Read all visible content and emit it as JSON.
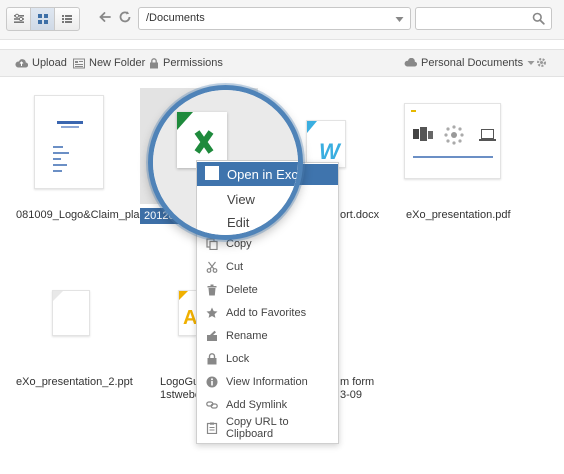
{
  "toolbar": {
    "path": "/Documents",
    "search_value": ""
  },
  "actions": {
    "upload": "Upload",
    "new_folder": "New Folder",
    "permissions": "Permissions",
    "drive": "Personal Documents"
  },
  "files": [
    {
      "name": "081009_Logo&Claim_pla"
    },
    {
      "name": "20120114_"
    },
    {
      "name": "ort.docx"
    },
    {
      "name": "eXo_presentation.pdf"
    },
    {
      "name": "eXo_presentation_2.ppt"
    },
    {
      "name_line1": "LogoGu",
      "name_line2": "1stwebc"
    },
    {
      "name_line1": "m form",
      "name_line2": "3-09"
    }
  ],
  "context_menu": {
    "items": [
      {
        "label": "Open in Excel",
        "icon": "excel-icon"
      },
      {
        "label": "View",
        "icon": "layers-icon"
      },
      {
        "label": "Edit",
        "icon": "edit-icon"
      },
      {
        "label": "Copy",
        "icon": "copy-icon"
      },
      {
        "label": "Cut",
        "icon": "scissors-icon"
      },
      {
        "label": "Delete",
        "icon": "trash-icon"
      },
      {
        "label": "Add to Favorites",
        "icon": "star-icon"
      },
      {
        "label": "Rename",
        "icon": "rename-icon"
      },
      {
        "label": "Lock",
        "icon": "lock-icon"
      },
      {
        "label": "View Information",
        "icon": "info-icon"
      },
      {
        "label": "Add Symlink",
        "icon": "link-icon"
      },
      {
        "label": "Copy URL to Clipboard",
        "icon": "clipboard-icon"
      }
    ]
  },
  "colors": {
    "accent": "#3f74ad",
    "magnifier_ring": "#4f83b8",
    "excel_green": "#1e8a3c"
  }
}
